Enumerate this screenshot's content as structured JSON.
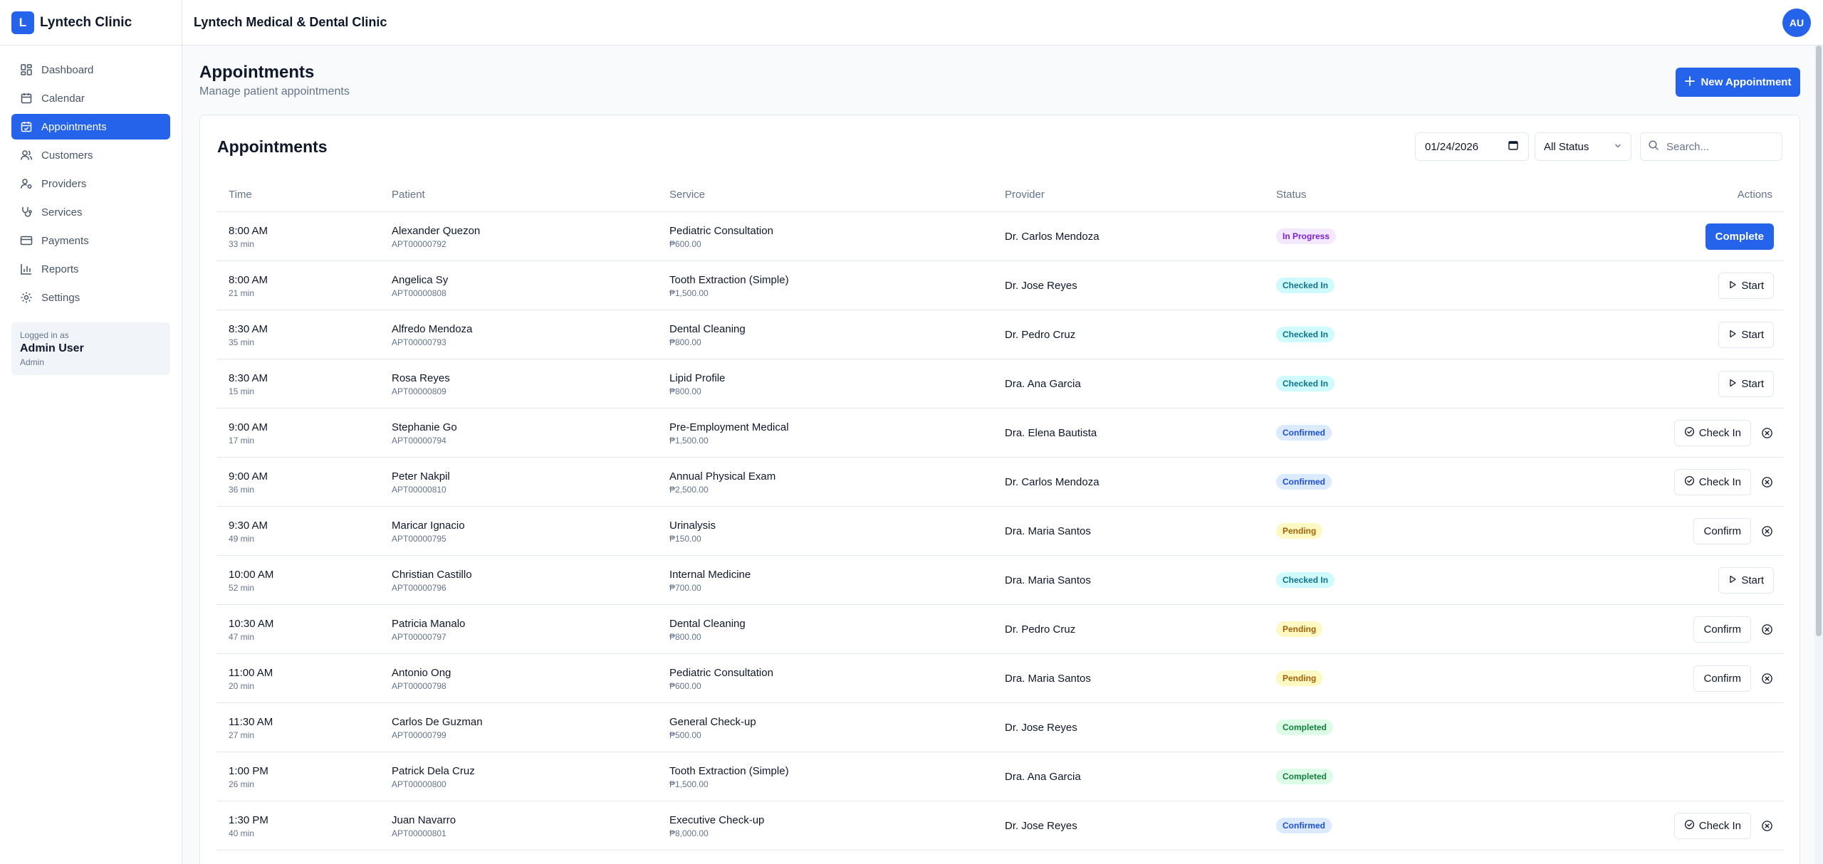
{
  "brand": {
    "logo_letter": "L",
    "name": "Lyntech Clinic"
  },
  "header": {
    "title": "Lyntech Medical & Dental Clinic",
    "avatar": "AU"
  },
  "sidebar": {
    "items": [
      {
        "label": "Dashboard",
        "icon": "dashboard-icon",
        "active": false
      },
      {
        "label": "Calendar",
        "icon": "calendar-icon",
        "active": false
      },
      {
        "label": "Appointments",
        "icon": "calendar-check-icon",
        "active": true
      },
      {
        "label": "Customers",
        "icon": "users-icon",
        "active": false
      },
      {
        "label": "Providers",
        "icon": "user-cog-icon",
        "active": false
      },
      {
        "label": "Services",
        "icon": "stethoscope-icon",
        "active": false
      },
      {
        "label": "Payments",
        "icon": "credit-card-icon",
        "active": false
      },
      {
        "label": "Reports",
        "icon": "bar-chart-icon",
        "active": false
      },
      {
        "label": "Settings",
        "icon": "gear-icon",
        "active": false
      }
    ],
    "user": {
      "caption": "Logged in as",
      "name": "Admin User",
      "role": "Admin"
    }
  },
  "page": {
    "title": "Appointments",
    "subtitle": "Manage patient appointments",
    "new_button": "New Appointment"
  },
  "card": {
    "title": "Appointments",
    "date_value": "01/24/2026",
    "status_filter": "All Status",
    "search_placeholder": "Search..."
  },
  "table": {
    "headers": {
      "time": "Time",
      "patient": "Patient",
      "service": "Service",
      "provider": "Provider",
      "status": "Status",
      "actions": "Actions"
    },
    "rows": [
      {
        "time": "8:00 AM",
        "duration": "33 min",
        "patient": "Alexander Quezon",
        "apt_id": "APT00000792",
        "service": "Pediatric Consultation",
        "price": "₱600.00",
        "provider": "Dr. Carlos Mendoza",
        "status": "In Progress",
        "action": "Complete",
        "action_type": "complete",
        "cancel": false
      },
      {
        "time": "8:00 AM",
        "duration": "21 min",
        "patient": "Angelica Sy",
        "apt_id": "APT00000808",
        "service": "Tooth Extraction (Simple)",
        "price": "₱1,500.00",
        "provider": "Dr. Jose Reyes",
        "status": "Checked In",
        "action": "Start",
        "action_type": "start",
        "cancel": false
      },
      {
        "time": "8:30 AM",
        "duration": "35 min",
        "patient": "Alfredo Mendoza",
        "apt_id": "APT00000793",
        "service": "Dental Cleaning",
        "price": "₱800.00",
        "provider": "Dr. Pedro Cruz",
        "status": "Checked In",
        "action": "Start",
        "action_type": "start",
        "cancel": false
      },
      {
        "time": "8:30 AM",
        "duration": "15 min",
        "patient": "Rosa Reyes",
        "apt_id": "APT00000809",
        "service": "Lipid Profile",
        "price": "₱800.00",
        "provider": "Dra. Ana Garcia",
        "status": "Checked In",
        "action": "Start",
        "action_type": "start",
        "cancel": false
      },
      {
        "time": "9:00 AM",
        "duration": "17 min",
        "patient": "Stephanie Go",
        "apt_id": "APT00000794",
        "service": "Pre-Employment Medical",
        "price": "₱1,500.00",
        "provider": "Dra. Elena Bautista",
        "status": "Confirmed",
        "action": "Check In",
        "action_type": "checkin",
        "cancel": true
      },
      {
        "time": "9:00 AM",
        "duration": "36 min",
        "patient": "Peter Nakpil",
        "apt_id": "APT00000810",
        "service": "Annual Physical Exam",
        "price": "₱2,500.00",
        "provider": "Dr. Carlos Mendoza",
        "status": "Confirmed",
        "action": "Check In",
        "action_type": "checkin",
        "cancel": true
      },
      {
        "time": "9:30 AM",
        "duration": "49 min",
        "patient": "Maricar Ignacio",
        "apt_id": "APT00000795",
        "service": "Urinalysis",
        "price": "₱150.00",
        "provider": "Dra. Maria Santos",
        "status": "Pending",
        "action": "Confirm",
        "action_type": "confirm",
        "cancel": true
      },
      {
        "time": "10:00 AM",
        "duration": "52 min",
        "patient": "Christian Castillo",
        "apt_id": "APT00000796",
        "service": "Internal Medicine",
        "price": "₱700.00",
        "provider": "Dra. Maria Santos",
        "status": "Checked In",
        "action": "Start",
        "action_type": "start",
        "cancel": false
      },
      {
        "time": "10:30 AM",
        "duration": "47 min",
        "patient": "Patricia Manalo",
        "apt_id": "APT00000797",
        "service": "Dental Cleaning",
        "price": "₱800.00",
        "provider": "Dr. Pedro Cruz",
        "status": "Pending",
        "action": "Confirm",
        "action_type": "confirm",
        "cancel": true
      },
      {
        "time": "11:00 AM",
        "duration": "20 min",
        "patient": "Antonio Ong",
        "apt_id": "APT00000798",
        "service": "Pediatric Consultation",
        "price": "₱600.00",
        "provider": "Dra. Maria Santos",
        "status": "Pending",
        "action": "Confirm",
        "action_type": "confirm",
        "cancel": true
      },
      {
        "time": "11:30 AM",
        "duration": "27 min",
        "patient": "Carlos De Guzman",
        "apt_id": "APT00000799",
        "service": "General Check-up",
        "price": "₱500.00",
        "provider": "Dr. Jose Reyes",
        "status": "Completed",
        "action": "",
        "action_type": "none",
        "cancel": false
      },
      {
        "time": "1:00 PM",
        "duration": "26 min",
        "patient": "Patrick Dela Cruz",
        "apt_id": "APT00000800",
        "service": "Tooth Extraction (Simple)",
        "price": "₱1,500.00",
        "provider": "Dra. Ana Garcia",
        "status": "Completed",
        "action": "",
        "action_type": "none",
        "cancel": false
      },
      {
        "time": "1:30 PM",
        "duration": "40 min",
        "patient": "Juan Navarro",
        "apt_id": "APT00000801",
        "service": "Executive Check-up",
        "price": "₱8,000.00",
        "provider": "Dr. Jose Reyes",
        "status": "Confirmed",
        "action": "Check In",
        "action_type": "checkin",
        "cancel": true
      }
    ]
  },
  "status_colors": {
    "In Progress": {
      "bg": "#f3e8ff",
      "fg": "#7e22ce"
    },
    "Checked In": {
      "bg": "#cffafe",
      "fg": "#0e7490"
    },
    "Confirmed": {
      "bg": "#dbeafe",
      "fg": "#1d4ed8"
    },
    "Pending": {
      "bg": "#fef9c3",
      "fg": "#a16207"
    },
    "Completed": {
      "bg": "#dcfce7",
      "fg": "#15803d"
    }
  }
}
